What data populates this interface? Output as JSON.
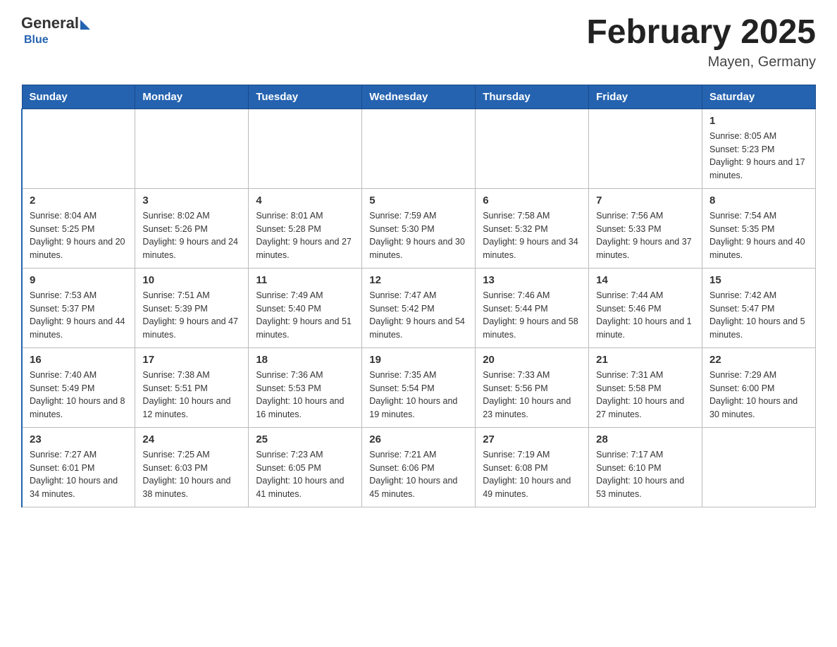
{
  "header": {
    "logo_text": "General",
    "logo_blue": "Blue",
    "title": "February 2025",
    "subtitle": "Mayen, Germany"
  },
  "days_of_week": [
    "Sunday",
    "Monday",
    "Tuesday",
    "Wednesday",
    "Thursday",
    "Friday",
    "Saturday"
  ],
  "weeks": [
    [
      {
        "day": "",
        "info": ""
      },
      {
        "day": "",
        "info": ""
      },
      {
        "day": "",
        "info": ""
      },
      {
        "day": "",
        "info": ""
      },
      {
        "day": "",
        "info": ""
      },
      {
        "day": "",
        "info": ""
      },
      {
        "day": "1",
        "info": "Sunrise: 8:05 AM\nSunset: 5:23 PM\nDaylight: 9 hours and 17 minutes."
      }
    ],
    [
      {
        "day": "2",
        "info": "Sunrise: 8:04 AM\nSunset: 5:25 PM\nDaylight: 9 hours and 20 minutes."
      },
      {
        "day": "3",
        "info": "Sunrise: 8:02 AM\nSunset: 5:26 PM\nDaylight: 9 hours and 24 minutes."
      },
      {
        "day": "4",
        "info": "Sunrise: 8:01 AM\nSunset: 5:28 PM\nDaylight: 9 hours and 27 minutes."
      },
      {
        "day": "5",
        "info": "Sunrise: 7:59 AM\nSunset: 5:30 PM\nDaylight: 9 hours and 30 minutes."
      },
      {
        "day": "6",
        "info": "Sunrise: 7:58 AM\nSunset: 5:32 PM\nDaylight: 9 hours and 34 minutes."
      },
      {
        "day": "7",
        "info": "Sunrise: 7:56 AM\nSunset: 5:33 PM\nDaylight: 9 hours and 37 minutes."
      },
      {
        "day": "8",
        "info": "Sunrise: 7:54 AM\nSunset: 5:35 PM\nDaylight: 9 hours and 40 minutes."
      }
    ],
    [
      {
        "day": "9",
        "info": "Sunrise: 7:53 AM\nSunset: 5:37 PM\nDaylight: 9 hours and 44 minutes."
      },
      {
        "day": "10",
        "info": "Sunrise: 7:51 AM\nSunset: 5:39 PM\nDaylight: 9 hours and 47 minutes."
      },
      {
        "day": "11",
        "info": "Sunrise: 7:49 AM\nSunset: 5:40 PM\nDaylight: 9 hours and 51 minutes."
      },
      {
        "day": "12",
        "info": "Sunrise: 7:47 AM\nSunset: 5:42 PM\nDaylight: 9 hours and 54 minutes."
      },
      {
        "day": "13",
        "info": "Sunrise: 7:46 AM\nSunset: 5:44 PM\nDaylight: 9 hours and 58 minutes."
      },
      {
        "day": "14",
        "info": "Sunrise: 7:44 AM\nSunset: 5:46 PM\nDaylight: 10 hours and 1 minute."
      },
      {
        "day": "15",
        "info": "Sunrise: 7:42 AM\nSunset: 5:47 PM\nDaylight: 10 hours and 5 minutes."
      }
    ],
    [
      {
        "day": "16",
        "info": "Sunrise: 7:40 AM\nSunset: 5:49 PM\nDaylight: 10 hours and 8 minutes."
      },
      {
        "day": "17",
        "info": "Sunrise: 7:38 AM\nSunset: 5:51 PM\nDaylight: 10 hours and 12 minutes."
      },
      {
        "day": "18",
        "info": "Sunrise: 7:36 AM\nSunset: 5:53 PM\nDaylight: 10 hours and 16 minutes."
      },
      {
        "day": "19",
        "info": "Sunrise: 7:35 AM\nSunset: 5:54 PM\nDaylight: 10 hours and 19 minutes."
      },
      {
        "day": "20",
        "info": "Sunrise: 7:33 AM\nSunset: 5:56 PM\nDaylight: 10 hours and 23 minutes."
      },
      {
        "day": "21",
        "info": "Sunrise: 7:31 AM\nSunset: 5:58 PM\nDaylight: 10 hours and 27 minutes."
      },
      {
        "day": "22",
        "info": "Sunrise: 7:29 AM\nSunset: 6:00 PM\nDaylight: 10 hours and 30 minutes."
      }
    ],
    [
      {
        "day": "23",
        "info": "Sunrise: 7:27 AM\nSunset: 6:01 PM\nDaylight: 10 hours and 34 minutes."
      },
      {
        "day": "24",
        "info": "Sunrise: 7:25 AM\nSunset: 6:03 PM\nDaylight: 10 hours and 38 minutes."
      },
      {
        "day": "25",
        "info": "Sunrise: 7:23 AM\nSunset: 6:05 PM\nDaylight: 10 hours and 41 minutes."
      },
      {
        "day": "26",
        "info": "Sunrise: 7:21 AM\nSunset: 6:06 PM\nDaylight: 10 hours and 45 minutes."
      },
      {
        "day": "27",
        "info": "Sunrise: 7:19 AM\nSunset: 6:08 PM\nDaylight: 10 hours and 49 minutes."
      },
      {
        "day": "28",
        "info": "Sunrise: 7:17 AM\nSunset: 6:10 PM\nDaylight: 10 hours and 53 minutes."
      },
      {
        "day": "",
        "info": ""
      }
    ]
  ]
}
